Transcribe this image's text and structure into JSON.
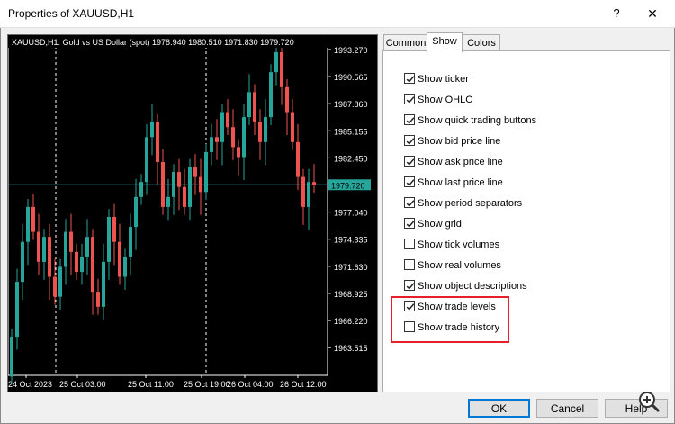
{
  "window": {
    "title": "Properties of XAUUSD,H1",
    "help_glyph": "?",
    "close_glyph": "✕"
  },
  "chart": {
    "header": "XAUUSD,H1:  Gold vs US Dollar (spot)  1978.940 1980.510 1971.830 1979.720",
    "current_price": "1979.720",
    "price_labels": [
      "1993.270",
      "1990.565",
      "1987.860",
      "1985.155",
      "1982.450",
      "1979.720",
      "1977.040",
      "1974.335",
      "1971.630",
      "1968.925",
      "1966.220",
      "1963.515"
    ],
    "time_labels": [
      "24 Oct 2023",
      "25 Oct 03:00",
      "25 Oct 11:00",
      "25 Oct 19:00",
      "26 Oct 04:00",
      "26 Oct 12:00"
    ],
    "colors": {
      "bull": "#26a69a",
      "bear": "#ef5350",
      "background": "#000000",
      "grid": "#ffffff",
      "price_line": "#26a69a"
    }
  },
  "tabs": [
    {
      "label": "Common",
      "active": false
    },
    {
      "label": "Show",
      "active": true
    },
    {
      "label": "Colors",
      "active": false
    }
  ],
  "options": [
    {
      "label": "Show ticker",
      "checked": true
    },
    {
      "label": "Show OHLC",
      "checked": true
    },
    {
      "label": "Show quick trading buttons",
      "checked": true
    },
    {
      "label": "Show bid price line",
      "checked": true
    },
    {
      "label": "Show ask price line",
      "checked": true
    },
    {
      "label": "Show last price line",
      "checked": true
    },
    {
      "label": "Show period separators",
      "checked": true
    },
    {
      "label": "Show grid",
      "checked": true
    },
    {
      "label": "Show tick volumes",
      "checked": false
    },
    {
      "label": "Show real volumes",
      "checked": false
    },
    {
      "label": "Show object descriptions",
      "checked": true
    },
    {
      "label": "Show trade levels",
      "checked": true
    },
    {
      "label": "Show trade history",
      "checked": false
    }
  ],
  "buttons": {
    "ok": "OK",
    "cancel": "Cancel",
    "help": "Help"
  },
  "highlight_color": "#e5202b"
}
